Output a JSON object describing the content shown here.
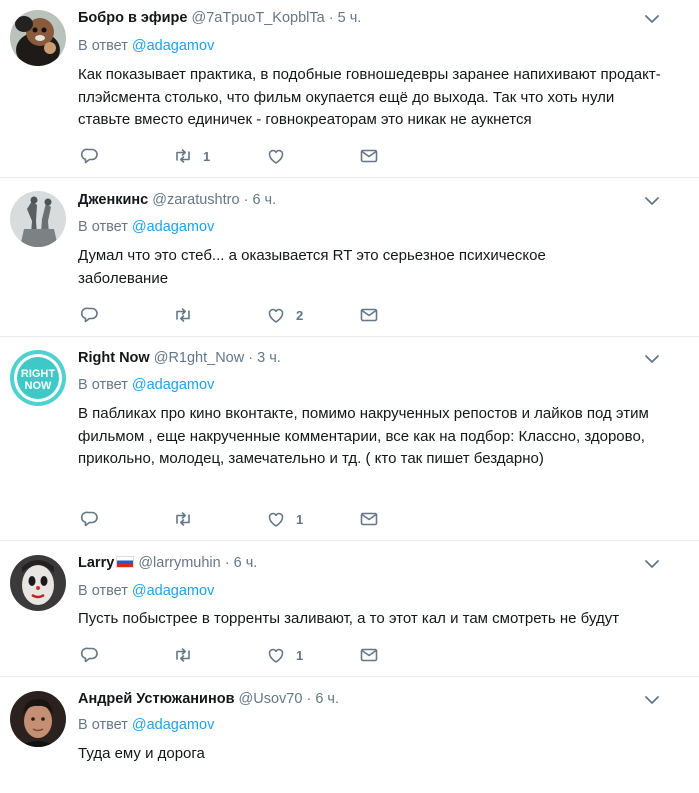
{
  "reply_prefix": "В ответ",
  "tweets": [
    {
      "name": "Бобро в эфире",
      "handle": "@7aTpuoT_KopblTa",
      "separator": "·",
      "time": "5 ч.",
      "reply_to": "@adagamov",
      "text": "Как показывает практика, в подобные говношедевры заранее напихивают продакт-плэйсмента столько, что фильм окупается ещё до выхода. Так что хоть нули ставьте вместо единичек - говнокреаторам это никак не аукнется",
      "counts": {
        "reply": "",
        "retweet": "1",
        "like": ""
      },
      "avatar": "beaver-avatar"
    },
    {
      "name": "Дженкинс",
      "handle": "@zaratushtro",
      "separator": "·",
      "time": "6 ч.",
      "reply_to": "@adagamov",
      "text": "Думал что это стеб... а оказывается RT это серьезное психическое заболевание",
      "counts": {
        "reply": "",
        "retweet": "",
        "like": "2"
      },
      "avatar": "statue-avatar"
    },
    {
      "name": "Right Now",
      "handle": "@R1ght_Now",
      "separator": "·",
      "time": "3 ч.",
      "reply_to": "@adagamov",
      "text": "В пабликах про кино вконтакте, помимо накрученных  репостов и лайков под этим фильмом , еще накрученные комментарии, все как на подбор: Классно, здорово, прикольно, молодец, замечательно и тд. ( кто так пишет бездарно)",
      "counts": {
        "reply": "",
        "retweet": "",
        "like": "1"
      },
      "avatar": "right-now-logo",
      "avatar_text": [
        "RIGHT",
        "NOW"
      ]
    },
    {
      "name": "Larry",
      "handle": "@larrymuhin",
      "separator": "·",
      "time": "6 ч.",
      "reply_to": "@adagamov",
      "text": "Пусть побыстрее в торренты заливают, а то этот кал и там смотреть не будут",
      "counts": {
        "reply": "",
        "retweet": "",
        "like": "1"
      },
      "avatar": "clown-avatar",
      "flag": "russia-flag-icon"
    },
    {
      "name": "Андрей Устюжанинов",
      "handle": "@Usov70",
      "separator": "·",
      "time": "6 ч.",
      "reply_to": "@adagamov",
      "text": "Туда ему и дорога",
      "counts": {
        "reply": "",
        "retweet": "",
        "like": ""
      },
      "avatar": "man-avatar"
    }
  ],
  "colors": {
    "link": "#1da1f2",
    "muted": "#657786",
    "divider": "#e6ecf0",
    "text": "#14171a"
  }
}
